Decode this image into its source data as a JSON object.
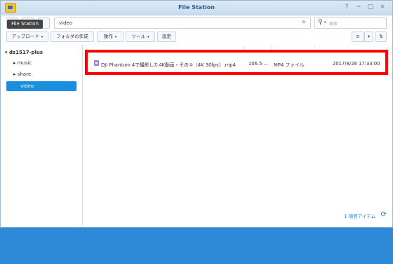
{
  "window": {
    "title": "File Station",
    "help": "?",
    "minimize": "−",
    "maximize": "□",
    "close": "×"
  },
  "tooltip": "File Station",
  "path": {
    "value": "video",
    "star": "★"
  },
  "search": {
    "placeholder": "検索",
    "icon": "⚲",
    "caret": "▾"
  },
  "toolbar": {
    "upload": "アップロード",
    "create_folder": "フォルダの作成",
    "action": "操作",
    "tools": "ツール",
    "settings": "設定",
    "caret": "▾"
  },
  "sidebar": {
    "root": "ds1517-plus",
    "items": [
      {
        "label": "music"
      },
      {
        "label": "share"
      },
      {
        "label": "video"
      }
    ]
  },
  "files": [
    {
      "name": "DJI Phantom 4で撮影した4K動画・その①（4K 30fps）.mp4",
      "size": "106.5 ...",
      "type": "MP4 ファイル",
      "modified": "2017/8/28 17:33:00"
    }
  ],
  "footer": {
    "items": "1 項目アイテム",
    "refresh": "⟳"
  },
  "colors": {
    "accent": "#1a8fe0",
    "highlight": "#ff0000"
  }
}
